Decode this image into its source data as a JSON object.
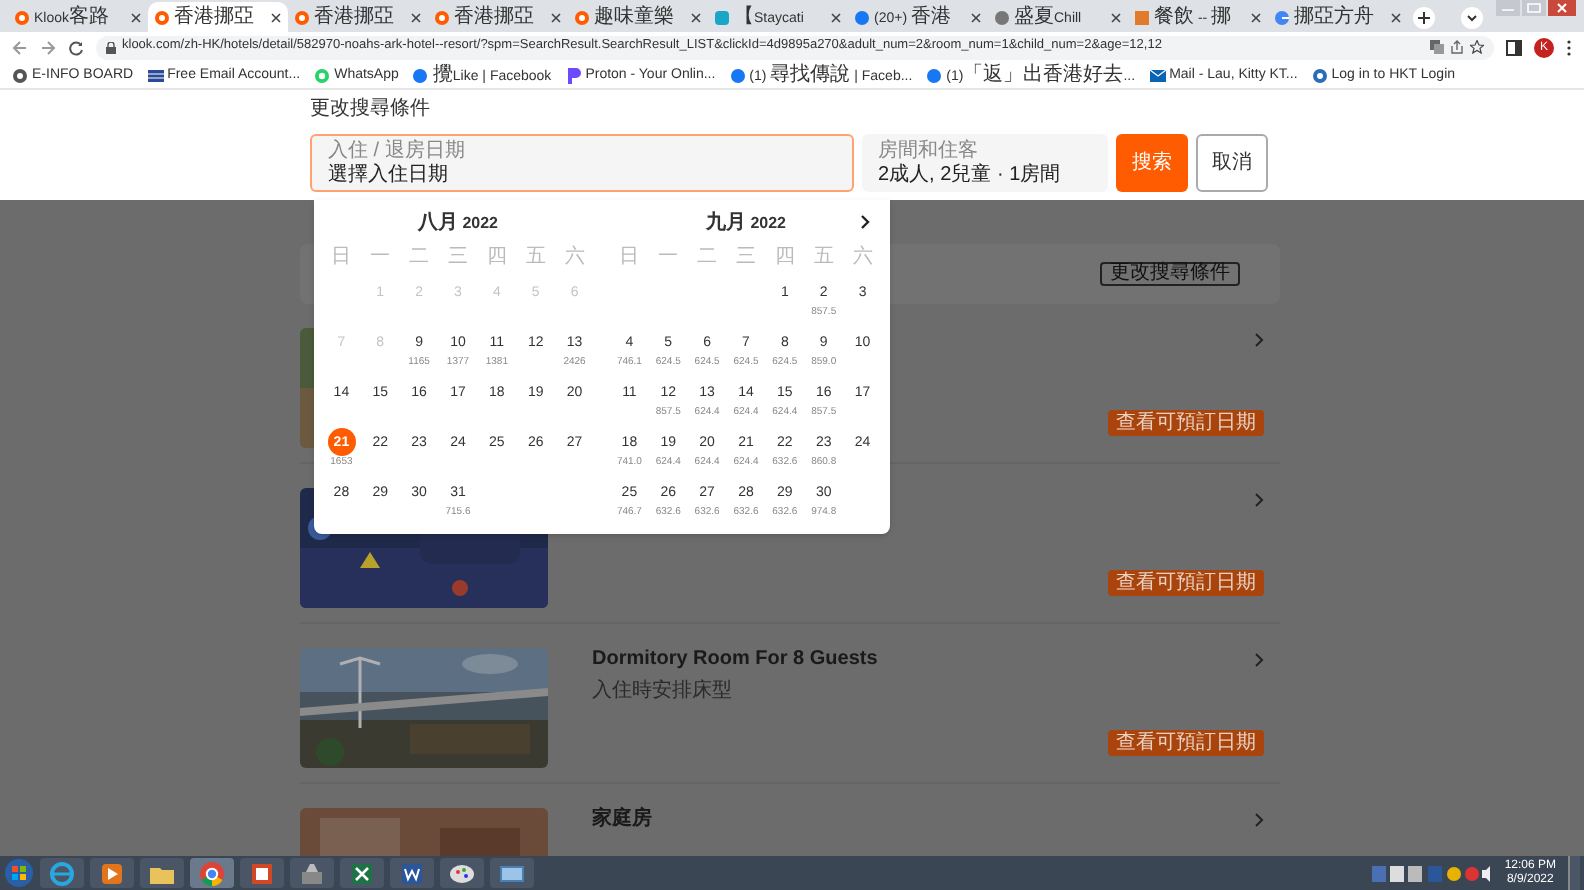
{
  "tabs": [
    {
      "label": "Klook客路",
      "selected": false
    },
    {
      "label": "香港挪亞",
      "selected": true
    },
    {
      "label": "香港挪亞",
      "selected": false
    },
    {
      "label": "香港挪亞",
      "selected": false
    },
    {
      "label": "趣味童樂",
      "selected": false
    },
    {
      "label": "【Staycati",
      "selected": false
    },
    {
      "label": "(20+) 香港",
      "selected": false
    },
    {
      "label": "盛夏Chill",
      "selected": false
    },
    {
      "label": "餐飲 -- 挪",
      "selected": false
    },
    {
      "label": "挪亞方舟",
      "selected": false
    }
  ],
  "address_bar": {
    "url": "klook.com/zh-HK/hotels/detail/582970-noahs-ark-hotel--resort/?spm=SearchResult.SearchResult_LIST&clickId=4d9895a270&adult_num=2&room_num=1&child_num=2&age=12,12",
    "profile": "K"
  },
  "bookmarks": [
    "E-INFO BOARD",
    "Free Email Account...",
    "WhatsApp",
    "攪Like | Facebook",
    "Proton - Your Onlin...",
    "(1) 尋找傳說 | Faceb...",
    "(1)「返」出香港好去...",
    "Mail - Lau, Kitty KT...",
    "Log in to HKT Login"
  ],
  "search": {
    "title": "更改搜尋條件",
    "date_field": {
      "label": "入住 / 退房日期",
      "value": "選擇入住日期"
    },
    "guest_field": {
      "label": "房間和住客",
      "value": "2成人, 2兒童 · 1房間"
    },
    "search_button": "搜索",
    "cancel_button": "取消"
  },
  "calendar": {
    "months": [
      {
        "title": "八月 2022",
        "weekdays": [
          "日",
          "一",
          "二",
          "三",
          "四",
          "五",
          "六"
        ],
        "weeks": [
          [
            {
              "day": "1",
              "disabled": true,
              "selected": false
            },
            {
              "day": "2",
              "disabled": true,
              "selected": false
            },
            {
              "day": "3",
              "disabled": true,
              "selected": false
            },
            {
              "day": "4",
              "disabled": true,
              "selected": false
            },
            {
              "day": "5",
              "disabled": true,
              "selected": false
            },
            {
              "day": "6",
              "disabled": true,
              "selected": false
            }
          ],
          [
            {
              "day": "7",
              "disabled": true,
              "selected": false
            },
            {
              "day": "8",
              "disabled": true,
              "selected": false
            },
            {
              "day": "9",
              "price": "1165",
              "disabled": false,
              "selected": false
            },
            {
              "day": "10",
              "price": "1377",
              "disabled": false,
              "selected": false
            },
            {
              "day": "11",
              "price": "1381",
              "disabled": false,
              "selected": false
            },
            {
              "day": "12",
              "disabled": false,
              "selected": false
            },
            {
              "day": "13",
              "price": "2426",
              "disabled": false,
              "selected": false
            }
          ],
          [
            {
              "day": "14",
              "disabled": false,
              "selected": false
            },
            {
              "day": "15",
              "disabled": false,
              "selected": false
            },
            {
              "day": "16",
              "disabled": false,
              "selected": false
            },
            {
              "day": "17",
              "disabled": false,
              "selected": false
            },
            {
              "day": "18",
              "disabled": false,
              "selected": false
            },
            {
              "day": "19",
              "disabled": false,
              "selected": false
            },
            {
              "day": "20",
              "disabled": false,
              "selected": false
            }
          ],
          [
            {
              "day": "21",
              "price": "1653",
              "disabled": false,
              "selected": true
            },
            {
              "day": "22",
              "disabled": false,
              "selected": false
            },
            {
              "day": "23",
              "disabled": false,
              "selected": false
            },
            {
              "day": "24",
              "disabled": false,
              "selected": false
            },
            {
              "day": "25",
              "disabled": false,
              "selected": false
            },
            {
              "day": "26",
              "disabled": false,
              "selected": false
            },
            {
              "day": "27",
              "disabled": false,
              "selected": false
            }
          ],
          [
            {
              "day": "28",
              "disabled": false,
              "selected": false
            },
            {
              "day": "29",
              "disabled": false,
              "selected": false
            },
            {
              "day": "30",
              "disabled": false,
              "selected": false
            },
            {
              "day": "31",
              "price": "715.6",
              "disabled": false,
              "selected": false
            }
          ]
        ]
      },
      {
        "title": "九月 2022",
        "weekdays": [
          "日",
          "一",
          "二",
          "三",
          "四",
          "五",
          "六"
        ],
        "weeks": [
          [
            {
              "day": "1",
              "disabled": false,
              "selected": false
            },
            {
              "day": "2",
              "price": "857.5",
              "disabled": false,
              "selected": false
            },
            {
              "day": "3",
              "disabled": false,
              "selected": false
            }
          ],
          [
            {
              "day": "4",
              "price": "746.1",
              "disabled": false,
              "selected": false
            },
            {
              "day": "5",
              "price": "624.5",
              "disabled": false,
              "selected": false
            },
            {
              "day": "6",
              "price": "624.5",
              "disabled": false,
              "selected": false
            },
            {
              "day": "7",
              "price": "624.5",
              "disabled": false,
              "selected": false
            },
            {
              "day": "8",
              "price": "624.5",
              "disabled": false,
              "selected": false
            },
            {
              "day": "9",
              "price": "859.0",
              "disabled": false,
              "selected": false
            },
            {
              "day": "10",
              "disabled": false,
              "selected": false
            }
          ],
          [
            {
              "day": "11",
              "disabled": false,
              "selected": false
            },
            {
              "day": "12",
              "price": "857.5",
              "disabled": false,
              "selected": false
            },
            {
              "day": "13",
              "price": "624.4",
              "disabled": false,
              "selected": false
            },
            {
              "day": "14",
              "price": "624.4",
              "disabled": false,
              "selected": false
            },
            {
              "day": "15",
              "price": "624.4",
              "disabled": false,
              "selected": false
            },
            {
              "day": "16",
              "price": "857.5",
              "disabled": false,
              "selected": false
            },
            {
              "day": "17",
              "disabled": false,
              "selected": false
            }
          ],
          [
            {
              "day": "18",
              "price": "741.0",
              "disabled": false,
              "selected": false
            },
            {
              "day": "19",
              "price": "624.4",
              "disabled": false,
              "selected": false
            },
            {
              "day": "20",
              "price": "624.4",
              "disabled": false,
              "selected": false
            },
            {
              "day": "21",
              "price": "624.4",
              "disabled": false,
              "selected": false
            },
            {
              "day": "22",
              "price": "632.6",
              "disabled": false,
              "selected": false
            },
            {
              "day": "23",
              "price": "860.8",
              "disabled": false,
              "selected": false
            },
            {
              "day": "24",
              "disabled": false,
              "selected": false
            }
          ],
          [
            {
              "day": "25",
              "price": "746.7",
              "disabled": false,
              "selected": false
            },
            {
              "day": "26",
              "price": "632.6",
              "disabled": false,
              "selected": false
            },
            {
              "day": "27",
              "price": "632.6",
              "disabled": false,
              "selected": false
            },
            {
              "day": "28",
              "price": "632.6",
              "disabled": false,
              "selected": false
            },
            {
              "day": "29",
              "price": "632.6",
              "disabled": false,
              "selected": false
            },
            {
              "day": "30",
              "price": "974.8",
              "disabled": false,
              "selected": false
            }
          ]
        ]
      }
    ]
  },
  "filter_bar": {
    "button": "更改搜尋條件"
  },
  "rooms": [
    {
      "button": "查看可預訂日期"
    },
    {
      "button": "查看可預訂日期"
    },
    {
      "name": "Dormitory Room For 8 Guests",
      "subtitle": "入住時安排床型",
      "button": "查看可預訂日期"
    },
    {
      "name": "家庭房"
    }
  ],
  "taskbar": {
    "time": "12:06 PM",
    "date": "8/9/2022"
  }
}
